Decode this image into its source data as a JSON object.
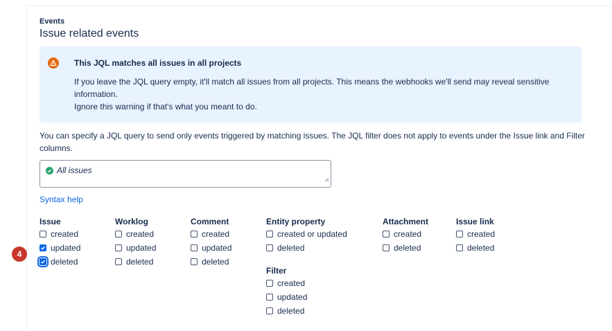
{
  "header": {
    "section_label": "Events",
    "title": "Issue related events"
  },
  "banner": {
    "icon": "warning-icon",
    "title": "This JQL matches all issues in all projects",
    "body_line1": "If you leave the JQL query empty, it'll match all issues from all projects. This means the webhooks we'll send may reveal sensitive information.",
    "body_line2": "Ignore this warning if that's what you meant to do.",
    "color_bg": "#e9f2ff",
    "color_icon": "#e56910"
  },
  "description": "You can specify a JQL query to send only events triggered by matching issues. The JQL filter does not apply to events under the Issue link and Filter columns.",
  "jql": {
    "value": "All issues",
    "status_icon": "check-circle-icon"
  },
  "syntax_help": "Syntax help",
  "columns": {
    "issue": {
      "title": "Issue",
      "options": [
        {
          "label": "created",
          "checked": false
        },
        {
          "label": "updated",
          "checked": true
        },
        {
          "label": "deleted",
          "checked": true
        }
      ]
    },
    "worklog": {
      "title": "Worklog",
      "options": [
        {
          "label": "created",
          "checked": false
        },
        {
          "label": "updated",
          "checked": false
        },
        {
          "label": "deleted",
          "checked": false
        }
      ]
    },
    "comment": {
      "title": "Comment",
      "options": [
        {
          "label": "created",
          "checked": false
        },
        {
          "label": "updated",
          "checked": false
        },
        {
          "label": "deleted",
          "checked": false
        }
      ]
    },
    "entity_property": {
      "title": "Entity property",
      "options": [
        {
          "label": "created or updated",
          "checked": false
        },
        {
          "label": "deleted",
          "checked": false
        }
      ]
    },
    "filter": {
      "title": "Filter",
      "options": [
        {
          "label": "created",
          "checked": false
        },
        {
          "label": "updated",
          "checked": false
        },
        {
          "label": "deleted",
          "checked": false
        }
      ]
    },
    "attachment": {
      "title": "Attachment",
      "options": [
        {
          "label": "created",
          "checked": false
        },
        {
          "label": "deleted",
          "checked": false
        }
      ]
    },
    "issue_link": {
      "title": "Issue link",
      "options": [
        {
          "label": "created",
          "checked": false
        },
        {
          "label": "deleted",
          "checked": false
        }
      ]
    }
  },
  "step_badge": "4"
}
